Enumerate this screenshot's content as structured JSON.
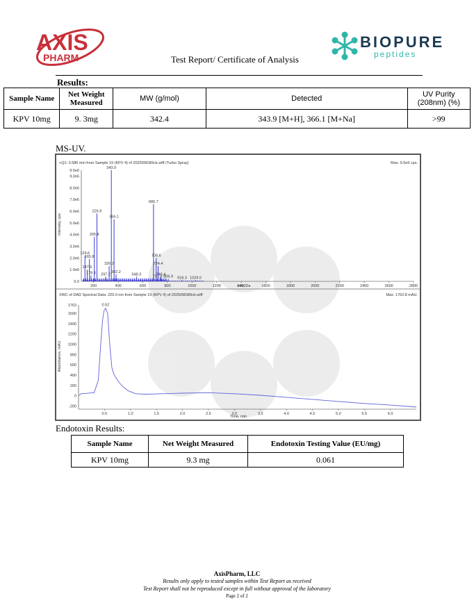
{
  "header": {
    "axis_logo": {
      "word": "AXIS",
      "sub": "PHARM"
    },
    "biopure_logo": {
      "word": "BIOPURE",
      "sub": "peptides"
    },
    "title": "Test Report/ Certificate of Analysis"
  },
  "results": {
    "label": "Results:",
    "columns": [
      "Sample Name",
      "Net Weight Measured",
      "MW (g/mol)",
      "Detected",
      "UV Purity (208nm) (%)"
    ],
    "row": [
      "KPV 10mg",
      "9. 3mg",
      "342.4",
      "343.9 [M+H], 366.1 [M+Na]",
      ">99"
    ]
  },
  "msuv_label": "MS-UV.",
  "chart_data": [
    {
      "type": "bar",
      "title": "+Q1: 0.586 min from Sample 19 (KPV 4) of 20250903Rick.wiff (Turbo Spray)",
      "max_label": "Max. 9.5e6 cps.",
      "xlabel": "m/z, Da",
      "ylabel": "Intensity, cps",
      "xlim": [
        100,
        2800
      ],
      "ylim": [
        0,
        9500000.0
      ],
      "xticks": [
        200,
        400,
        600,
        800,
        1000,
        1200,
        1400,
        1600,
        1800,
        2000,
        2200,
        2400,
        2600,
        2800
      ],
      "yticks": [
        "0.0",
        "1.0e6",
        "2.0e6",
        "3.0e6",
        "4.0e6",
        "5.0e6",
        "6.0e6",
        "7.0e6",
        "8.0e6",
        "9.0e6",
        "9.5e6"
      ],
      "ytick_values": [
        0,
        1000000.0,
        2000000.0,
        3000000.0,
        4000000.0,
        5000000.0,
        6000000.0,
        7000000.0,
        8000000.0,
        9000000.0,
        9500000.0
      ],
      "peaks": [
        {
          "mz": 129.6,
          "intensity": 2200000.0,
          "label": "129.6"
        },
        {
          "mz": 147.6,
          "intensity": 1000000.0,
          "label": "147.6"
        },
        {
          "mz": 165.8,
          "intensity": 1900000.0,
          "label": "165.8"
        },
        {
          "mz": 178.8,
          "intensity": 500000.0,
          "label": "178.8"
        },
        {
          "mz": 205.8,
          "intensity": 3800000.0,
          "label": "205.8"
        },
        {
          "mz": 226.9,
          "intensity": 5800000.0,
          "label": "226.9"
        },
        {
          "mz": 297.2,
          "intensity": 400000.0,
          "label": "297.2"
        },
        {
          "mz": 326.2,
          "intensity": 1300000.0,
          "label": "326.2"
        },
        {
          "mz": 343.9,
          "intensity": 9500000.0,
          "label": "343.9"
        },
        {
          "mz": 366.1,
          "intensity": 5300000.0,
          "label": "366.1"
        },
        {
          "mz": 382.2,
          "intensity": 600000.0,
          "label": "382.2"
        },
        {
          "mz": 548.3,
          "intensity": 400000.0,
          "label": "548.3"
        },
        {
          "mz": 686.7,
          "intensity": 6600000.0,
          "label": "686.7"
        },
        {
          "mz": 708.6,
          "intensity": 2000000.0,
          "label": "708.6"
        },
        {
          "mz": 717.3,
          "intensity": 200000.0,
          "label": "717.3"
        },
        {
          "mz": 724.4,
          "intensity": 1300000.0,
          "label": "724.4"
        },
        {
          "mz": 746.4,
          "intensity": 400000.0,
          "label": "746.4"
        },
        {
          "mz": 806.9,
          "intensity": 200000.0,
          "label": "806.9"
        },
        {
          "mz": 918.3,
          "intensity": 100000.0,
          "label": "918.3"
        },
        {
          "mz": 1029.0,
          "intensity": 100000.0,
          "label": "1029.0"
        }
      ]
    },
    {
      "type": "line",
      "title": "XWC of DAD Spectral Data: 220.0 nm from Sample 19 (KPV 4) of 20250903Rick.wiff",
      "max_label": "Max. 1762.8 mAU.",
      "xlabel": "Time, min",
      "ylabel": "Absorbance, mAU",
      "xlim": [
        0,
        6.5
      ],
      "ylim": [
        -260,
        1763
      ],
      "xticks": [
        "0.5",
        "1.0",
        "1.5",
        "2.0",
        "2.5",
        "3.0",
        "3.5",
        "4.0",
        "4.5",
        "5.0",
        "5.5",
        "6.0"
      ],
      "xtick_values": [
        0.5,
        1.0,
        1.5,
        2.0,
        2.5,
        3.0,
        3.5,
        4.0,
        4.5,
        5.0,
        5.5,
        6.0
      ],
      "yticks": [
        "1763",
        "1600",
        "1400",
        "1200",
        "1000",
        "800",
        "600",
        "400",
        "200",
        "0",
        "-200"
      ],
      "ytick_values": [
        1763,
        1600,
        1400,
        1200,
        1000,
        800,
        600,
        400,
        200,
        0,
        -200
      ],
      "peak_label": "0.52",
      "series": [
        {
          "x": [
            0,
            0.05,
            0.3,
            0.38,
            0.42,
            0.46,
            0.49,
            0.52,
            0.56,
            0.6,
            0.64,
            0.68,
            0.72,
            0.78,
            0.85,
            0.95,
            1.1,
            1.3,
            1.6,
            2.0,
            2.5,
            3.0,
            3.5,
            4.0,
            4.5,
            5.0,
            5.5,
            6.0,
            6.5
          ],
          "y": [
            0,
            40,
            60,
            300,
            900,
            1450,
            1650,
            1700,
            1600,
            1000,
            550,
            420,
            350,
            260,
            180,
            100,
            40,
            30,
            40,
            50,
            60,
            40,
            10,
            -30,
            -70,
            -110,
            -150,
            -180,
            -220
          ]
        }
      ]
    }
  ],
  "endotoxin": {
    "label": "Endotoxin Results:",
    "columns": [
      "Sample Name",
      "Net Weight Measured",
      "Endotoxin Testing Value (EU/mg)"
    ],
    "row": [
      "KPV 10mg",
      "9.3 mg",
      "0.061"
    ]
  },
  "footer": {
    "company": "AxisPharm, LLC",
    "line1": "Results only apply to tested samples within Test Report as received",
    "line2": "Test Report shall not be reproduced except in full without approval of the laboratory",
    "page": "Page 2 of 2"
  }
}
